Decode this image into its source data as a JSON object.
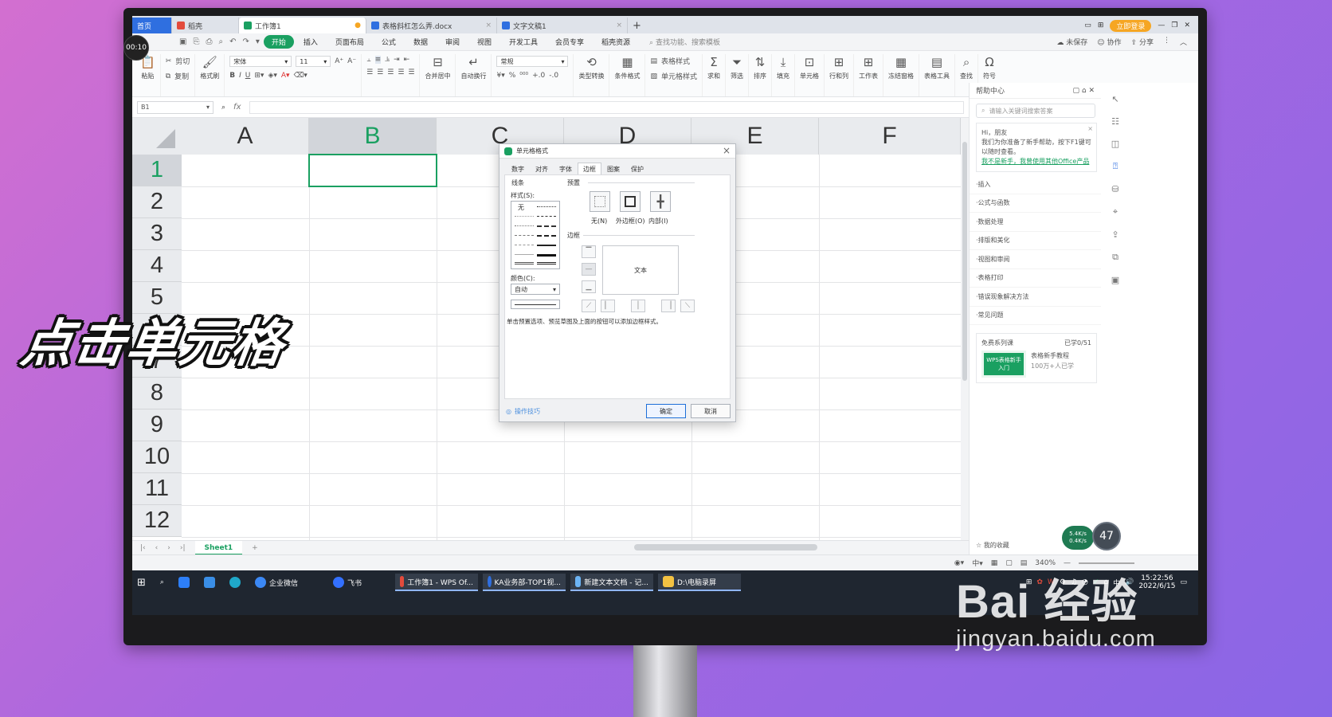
{
  "tabs": [
    {
      "label": "首页",
      "color": "#2f6fe0"
    },
    {
      "label": "稻壳",
      "color": "#e34b3c"
    },
    {
      "label": "工作簿1",
      "color": "#1aa061"
    },
    {
      "label": "表格斜杠怎么弄.docx",
      "color": "#2f6fe0"
    },
    {
      "label": "文字文稿1",
      "color": "#2f6fe0"
    }
  ],
  "login": "立即登录",
  "menus": [
    "开始",
    "插入",
    "页面布局",
    "公式",
    "数据",
    "审阅",
    "视图",
    "开发工具",
    "会员专享",
    "稻壳资源"
  ],
  "menu_search": "查找功能、搜索模板",
  "menu_right": [
    "未保存",
    "协作",
    "分享"
  ],
  "ribbon": {
    "cut": "剪切",
    "paste": "粘贴",
    "copy": "复制",
    "painter": "格式刷",
    "font_name": "宋体",
    "font_size": "11",
    "merge": "合并居中",
    "wrap": "自动换行",
    "number_format": "常规",
    "convert": "类型转换",
    "cond_format": "条件格式",
    "table_style": "表格样式",
    "cell_style": "单元格样式",
    "sum": "求和",
    "filter": "筛选",
    "sort": "排序",
    "fill": "填充",
    "cell": "单元格",
    "rowcol": "行和列",
    "sheet": "工作表",
    "freeze": "冻结窗格",
    "tools": "表格工具",
    "find": "查找",
    "symbol": "符号"
  },
  "namebox": "B1",
  "columns": [
    "A",
    "B",
    "C",
    "D",
    "E",
    "F"
  ],
  "rows": [
    "1",
    "2",
    "3",
    "4",
    "5",
    "6",
    "7",
    "8",
    "9",
    "10",
    "11",
    "12"
  ],
  "sheet_tab": "Sheet1",
  "zoom": "340%",
  "dialog": {
    "title": "单元格格式",
    "tabs": [
      "数字",
      "对齐",
      "字体",
      "边框",
      "图案",
      "保护"
    ],
    "line_section": "线条",
    "style_label": "样式(S):",
    "none_style": "无",
    "color_label": "颜色(C):",
    "color_value": "自动",
    "preset_section": "预置",
    "presets": [
      "无(N)",
      "外边框(O)",
      "内部(I)"
    ],
    "border_section": "边框",
    "preview_text": "文本",
    "hint": "单击预置选项、预览草图及上面的按钮可以添加边框样式。",
    "tips": "操作技巧",
    "ok": "确定",
    "cancel": "取消"
  },
  "side": {
    "title": "帮助中心",
    "search_placeholder": "请输入关键词搜索答案",
    "greet": "Hi，朋友",
    "intro": "我们为你准备了新手帮助，按下F1键可以随时查看。",
    "link": "我不是新手，我曾使用其他Office产品",
    "items": [
      "插入",
      "公式与函数",
      "数据处理",
      "排版和美化",
      "视图和审阅",
      "表格打印",
      "错误现象解决方法",
      "常见问题"
    ],
    "course_label": "免费系列课",
    "course_progress": "已学0/51",
    "course_thumb": "WPS表格新手入门",
    "course_title": "表格新手教程",
    "course_count": "100万+人已学",
    "fav": "我的收藏"
  },
  "taskbar": {
    "wechat": "企业微信",
    "feishu": "飞书",
    "apps": [
      "工作簿1 - WPS Of...",
      "KA业务部-TOP1视...",
      "新建文本文档 - 记...",
      "D:\\电脑录屏"
    ],
    "time": "15:22:56",
    "date": "2022/6/15",
    "lang": "中"
  },
  "overlay": "点击单元格",
  "timer": "00:10",
  "badge": "47",
  "speed": [
    "5.4K/s",
    "0.4K/s"
  ],
  "watermark": {
    "brand": "Bai 经验",
    "url": "jingyan.baidu.com"
  }
}
